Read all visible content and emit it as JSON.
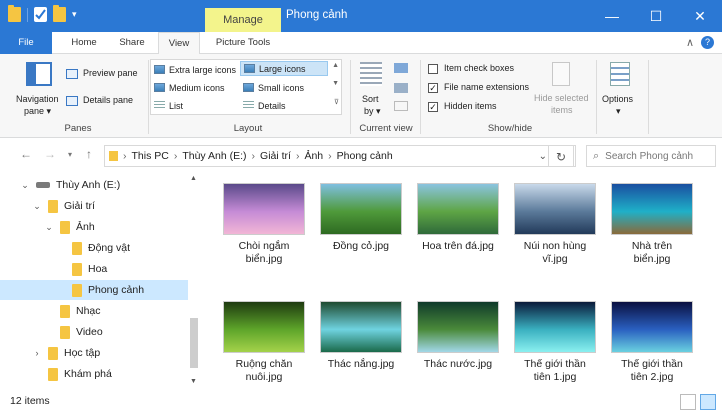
{
  "window": {
    "context_tab": "Manage",
    "title": "Phong cảnh",
    "controls": [
      "minimize-icon",
      "maximize-icon",
      "close-icon"
    ]
  },
  "ribbon_tabs": {
    "file": "File",
    "home": "Home",
    "share": "Share",
    "view": "View",
    "picture_tools": "Picture Tools"
  },
  "ribbon": {
    "panes": {
      "label": "Panes",
      "navigation_pane_line1": "Navigation",
      "navigation_pane_line2": "pane",
      "preview_pane": "Preview pane",
      "details_pane": "Details pane"
    },
    "layout": {
      "label": "Layout",
      "items": {
        "extra_large_icons": "Extra large icons",
        "large_icons": "Large icons",
        "medium_icons": "Medium icons",
        "small_icons": "Small icons",
        "list": "List",
        "details": "Details"
      },
      "selected": "Large icons"
    },
    "current_view": {
      "label": "Current view",
      "sort_line1": "Sort",
      "sort_line2": "by"
    },
    "show_hide": {
      "label": "Show/hide",
      "item_check_boxes": "Item check boxes",
      "file_name_extensions": "File name extensions",
      "hidden_items": "Hidden items",
      "item_check_boxes_checked": false,
      "file_name_extensions_checked": true,
      "hidden_items_checked": true,
      "hide_selected_line1": "Hide selected",
      "hide_selected_line2": "items"
    },
    "options": {
      "label": "Options"
    }
  },
  "address": {
    "crumbs": [
      "This PC",
      "Thùy Anh (E:)",
      "Giải trí",
      "Ảnh",
      "Phong cảnh"
    ],
    "search_placeholder": "Search Phong cảnh"
  },
  "nav_tree": [
    {
      "label": "Thùy Anh (E:)",
      "level": 0,
      "expanded": true,
      "type": "drive"
    },
    {
      "label": "Giải trí",
      "level": 1,
      "expanded": true,
      "type": "folder"
    },
    {
      "label": "Ảnh",
      "level": 2,
      "expanded": true,
      "type": "folder"
    },
    {
      "label": "Động vật",
      "level": 3,
      "type": "folder"
    },
    {
      "label": "Hoa",
      "level": 3,
      "type": "folder"
    },
    {
      "label": "Phong cảnh",
      "level": 3,
      "type": "folder",
      "selected": true
    },
    {
      "label": "Nhạc",
      "level": 2,
      "type": "folder"
    },
    {
      "label": "Video",
      "level": 2,
      "type": "folder"
    },
    {
      "label": "Học tập",
      "level": 1,
      "expanded": false,
      "type": "folder"
    },
    {
      "label": "Khám phá",
      "level": 1,
      "type": "folder"
    }
  ],
  "files": [
    {
      "name_line1": "Chòi ngắm",
      "name_line2": "biển.jpg",
      "colors": [
        "#5a4a8a",
        "#c58bd6",
        "#f2b6d6"
      ]
    },
    {
      "name_line1": "Đồng cỏ.jpg",
      "name_line2": "",
      "colors": [
        "#7fbfe0",
        "#4f9a3a",
        "#2e6a22"
      ]
    },
    {
      "name_line1": "Hoa trên đá.jpg",
      "name_line2": "",
      "colors": [
        "#8bc4e0",
        "#5ea545",
        "#2f6a3a"
      ]
    },
    {
      "name_line1": "Núi non hùng",
      "name_line2": "vĩ.jpg",
      "colors": [
        "#c9d9ea",
        "#5b7a9a",
        "#223a5a"
      ]
    },
    {
      "name_line1": "Nhà trên",
      "name_line2": "biển.jpg",
      "colors": [
        "#1a4fa0",
        "#1fb0c8",
        "#8a6a3a"
      ]
    },
    {
      "name_line1": "Ruộng chăn",
      "name_line2": "nuôi.jpg",
      "colors": [
        "#1e3a10",
        "#5ea52a",
        "#a4d24a"
      ]
    },
    {
      "name_line1": "Thác nắng.jpg",
      "name_line2": "",
      "colors": [
        "#1f4a30",
        "#6fd3e0",
        "#1a6a4a"
      ]
    },
    {
      "name_line1": "Thác nước.jpg",
      "name_line2": "",
      "colors": [
        "#0f3a2a",
        "#4a8a3a",
        "#a2d8e8"
      ]
    },
    {
      "name_line1": "Thế giới thần",
      "name_line2": "tiên 1.jpg",
      "colors": [
        "#0a1a3a",
        "#3ab0c0",
        "#8af0f0"
      ]
    },
    {
      "name_line1": "Thế giới thần",
      "name_line2": "tiên 2.jpg",
      "colors": [
        "#0a1040",
        "#2a60c0",
        "#6ad0e0"
      ]
    }
  ],
  "status": {
    "count": "12 items"
  }
}
